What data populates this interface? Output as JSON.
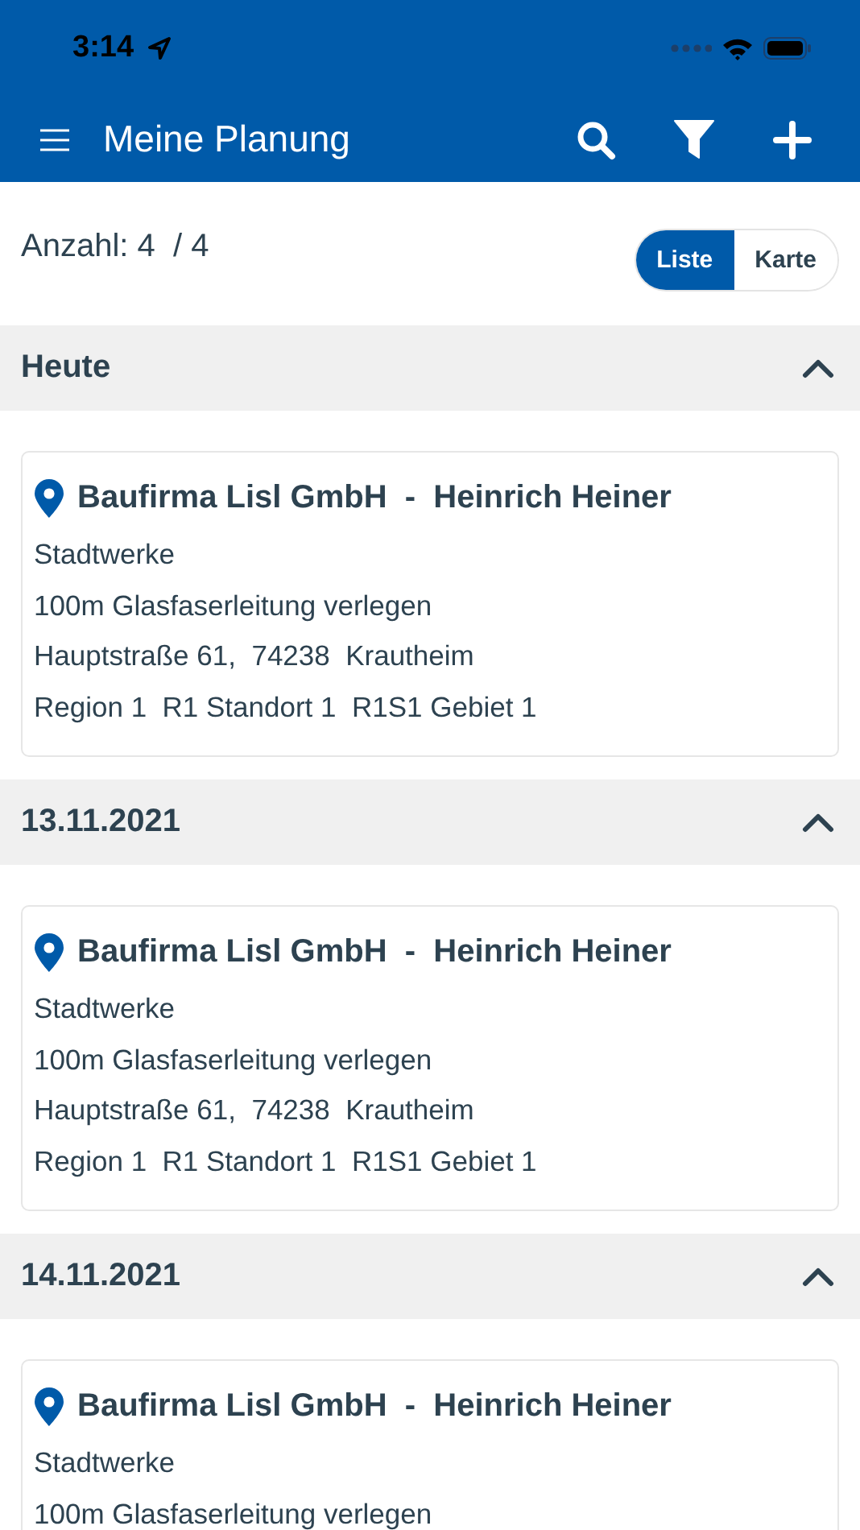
{
  "status_bar": {
    "time": "3:14"
  },
  "app_bar": {
    "title": "Meine Planung"
  },
  "summary": {
    "count": "Anzahl: 4  / 4"
  },
  "view_toggle": [
    {
      "label": "Liste",
      "selected": true
    },
    {
      "label": "Karte",
      "selected": false
    }
  ],
  "sections": [
    {
      "date": "Heute",
      "expanded": true,
      "items": [
        {
          "title": "Baufirma Lisl GmbH  -  Heinrich Heiner",
          "lines": [
            "Stadtwerke",
            "100m Glasfaserleitung verlegen",
            "Hauptstraße 61,  74238  Krautheim",
            "Region 1  R1 Standort 1  R1S1 Gebiet 1"
          ]
        }
      ]
    },
    {
      "date": "13.11.2021",
      "expanded": true,
      "items": [
        {
          "title": "Baufirma Lisl GmbH  -  Heinrich Heiner",
          "lines": [
            "Stadtwerke",
            "100m Glasfaserleitung verlegen",
            "Hauptstraße 61,  74238  Krautheim",
            "Region 1  R1 Standort 1  R1S1 Gebiet 1"
          ]
        }
      ]
    },
    {
      "date": "14.11.2021",
      "expanded": true,
      "items": [
        {
          "title": "Baufirma Lisl GmbH  -  Heinrich Heiner",
          "lines": [
            "Stadtwerke",
            "100m Glasfaserleitung verlegen"
          ]
        }
      ]
    }
  ]
}
